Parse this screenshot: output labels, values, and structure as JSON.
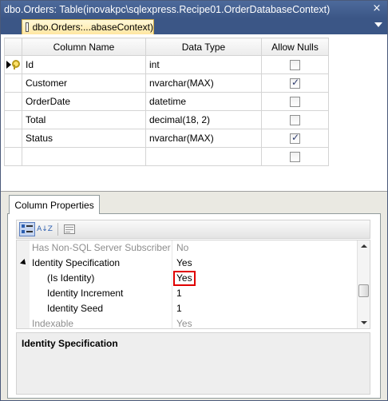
{
  "window": {
    "title": "dbo.Orders: Table(inovakpc\\sqlexpress.Recipe01.OrderDatabaseContext)",
    "close_glyph": "×"
  },
  "tabs": [
    {
      "label": "dbo.Orders:...abaseContext)",
      "active": true
    }
  ],
  "designer": {
    "columns": [
      "Column Name",
      "Data Type",
      "Allow Nulls"
    ],
    "rows": [
      {
        "name": "Id",
        "type": "int",
        "allow_nulls": false,
        "primary_key": true
      },
      {
        "name": "Customer",
        "type": "nvarchar(MAX)",
        "allow_nulls": true
      },
      {
        "name": "OrderDate",
        "type": "datetime",
        "allow_nulls": false
      },
      {
        "name": "Total",
        "type": "decimal(18, 2)",
        "allow_nulls": false
      },
      {
        "name": "Status",
        "type": "nvarchar(MAX)",
        "allow_nulls": true
      },
      {
        "name": "",
        "type": "",
        "allow_nulls": false
      }
    ]
  },
  "column_properties": {
    "tab_label": "Column Properties",
    "toolbar": {
      "categorized_icon": "categorized-icon",
      "alphabetical_label": "A↓Z",
      "property_pages_icon": "property-pages-icon"
    },
    "properties": [
      {
        "name": "Has Non-SQL Server Subscriber",
        "value": "No",
        "dim": true,
        "indent": 0
      },
      {
        "name": "Identity Specification",
        "value": "Yes",
        "dim": false,
        "indent": 0,
        "expanded": true
      },
      {
        "name": "(Is Identity)",
        "value": "Yes",
        "dim": false,
        "indent": 1,
        "highlighted": true
      },
      {
        "name": "Identity Increment",
        "value": "1",
        "dim": false,
        "indent": 1
      },
      {
        "name": "Identity Seed",
        "value": "1",
        "dim": false,
        "indent": 1
      },
      {
        "name": "Indexable",
        "value": "Yes",
        "dim": true,
        "indent": 0
      }
    ],
    "description_title": "Identity Specification"
  },
  "colors": {
    "title_bar": "#3b5686",
    "active_tab": "#ffe7a2",
    "highlight_border": "#e00000"
  }
}
